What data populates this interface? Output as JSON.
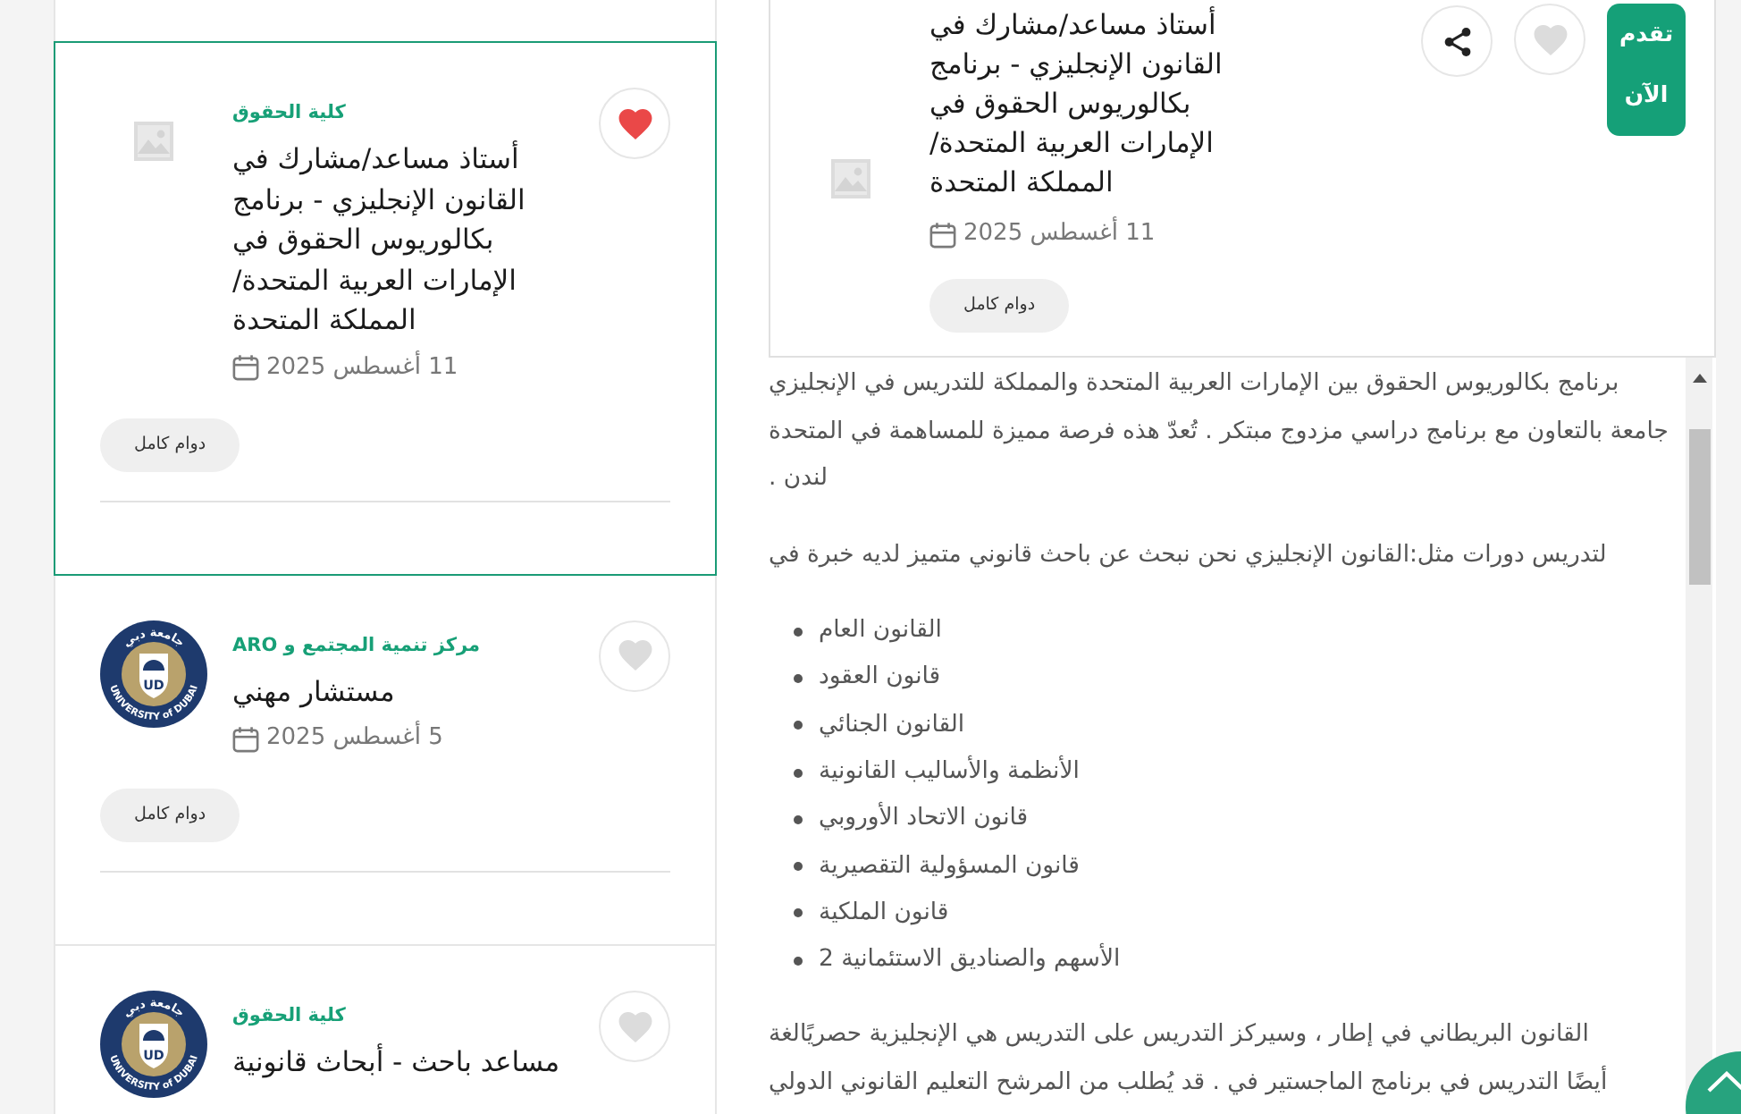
{
  "job_list": {
    "cards": [
      {
        "kind": "placeholder",
        "selected": true,
        "favorite": true,
        "employer": "كلية الحقوق",
        "title": "أستاذ مساعد/مشارك في القانون الإنجليزي - برنامج بكالوريوس الحقوق في الإمارات العربية المتحدة/المملكة المتحدة",
        "date": "11 أغسطس 2025",
        "tag": "دوام كامل"
      },
      {
        "kind": "logo",
        "logo": {
          "arabic_text": "جامعة دبي",
          "initials": "UD",
          "ring_text": "UNIVERSITY of DUBAI"
        },
        "selected": false,
        "favorite": false,
        "employer": "مركز تنمية المجتمع و ARO",
        "title": "مستشار مهني",
        "date": "5 أغسطس 2025",
        "tag": "دوام كامل"
      },
      {
        "kind": "logo",
        "logo": {
          "arabic_text": "جامعة دبي",
          "initials": "UD",
          "ring_text": "UNIVERSITY of DUBAI"
        },
        "selected": false,
        "favorite": false,
        "employer": "كلية الحقوق",
        "title": "مساعد باحث - أبحاث قانونية"
      }
    ]
  },
  "job_detail": {
    "kind": "placeholder",
    "title": "أستاذ مساعد/مشارك في القانون الإنجليزي - برنامج بكالوريوس الحقوق في الإمارات العربية المتحدة/المملكة المتحدة",
    "date": "11 أغسطس 2025",
    "tag": "دوام كامل",
    "favorite": false,
    "apply_label": "تقدم الآن",
    "description": [
      {
        "kind": "paragraph",
        "lines": [
          "برنامج بكالوريوس الحقوق بين الإمارات العربية المتحدة والمملكة للتدريس في الإنجليزي",
          "جامعة بالتعاون مع برنامج دراسي مزدوج مبتكر . تُعدّ هذه فرصة مميزة للمساهمة في المتحدة",
          "لندن ."
        ]
      },
      {
        "kind": "paragraph",
        "lines": [
          "لتدريس دورات مثل:القانون الإنجليزي نحن نبحث عن باحث قانوني متميز لديه خبرة في"
        ]
      },
      {
        "kind": "list",
        "items": [
          "القانون العام",
          "قانون العقود",
          "القانون الجنائي",
          "الأنظمة والأساليب القانونية",
          "قانون الاتحاد الأوروبي",
          "قانون المسؤولية التقصيرية",
          "قانون الملكية",
          "الأسهم والصناديق الاستئمانية 2"
        ]
      },
      {
        "kind": "paragraph",
        "lines": [
          "القانون البريطاني في إطار ، وسيركز التدريس على التدريس هي الإنجليزية حصريًالغة",
          "أيضًا التدريس في برنامج الماجستير في . قد يُطلب من المرشح التعليم القانوني الدولي"
        ]
      }
    ]
  }
}
